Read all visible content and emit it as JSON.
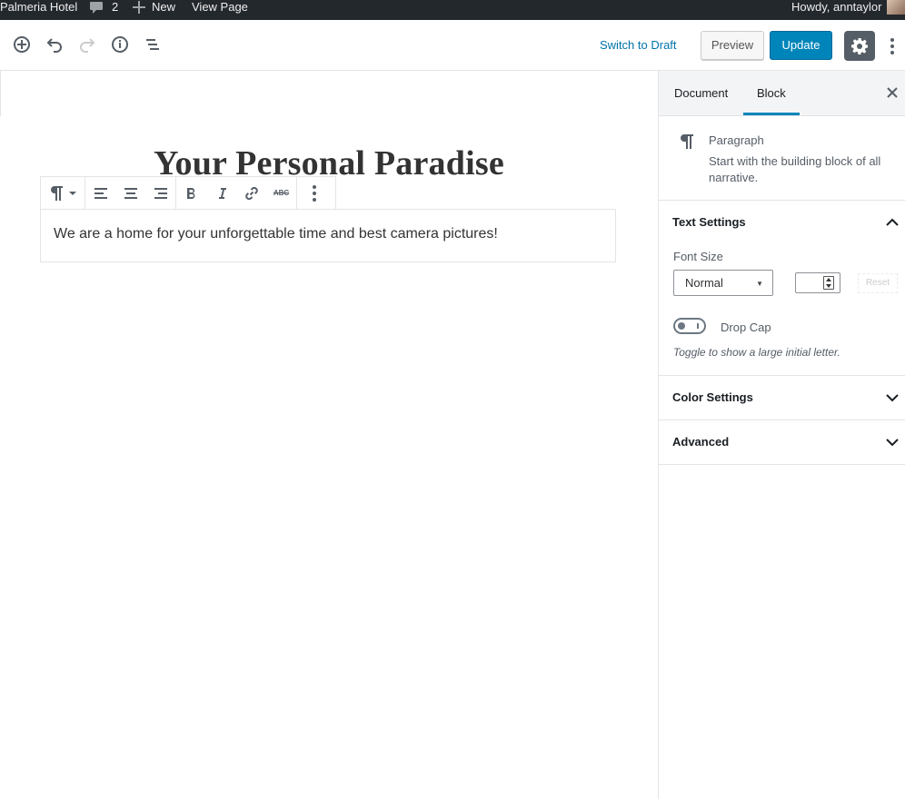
{
  "adminbar": {
    "site_name": "Palmeria Hotel",
    "comments_count": "2",
    "new_label": "New",
    "view_page_label": "View Page",
    "howdy": "Howdy, anntaylor",
    "bg_color": "#23282d"
  },
  "header": {
    "switch_to_draft": "Switch to Draft",
    "preview_label": "Preview",
    "update_label": "Update",
    "icons": [
      "add-block-icon",
      "undo-icon",
      "redo-icon",
      "info-icon",
      "outline-icon",
      "gear-icon",
      "more-vertical-icon"
    ],
    "accent_color": "#0085ba"
  },
  "content": {
    "title": "Your Personal Paradise",
    "paragraph": "We are a home for your unforgettable time and best camera pictures!",
    "toolbar_icons": [
      "paragraph-icon",
      "align-left-icon",
      "align-center-icon",
      "align-right-icon",
      "bold-icon",
      "italic-icon",
      "link-icon",
      "strikethrough-icon",
      "more-options-icon"
    ],
    "strike_label": "ABC"
  },
  "sidebar": {
    "tabs": [
      {
        "label": "Document",
        "active": false
      },
      {
        "label": "Block",
        "active": true
      }
    ],
    "block_card": {
      "title": "Paragraph",
      "description": "Start with the building block of all narrative."
    },
    "text_settings": {
      "title": "Text Settings",
      "expanded": true,
      "font_size_label": "Font Size",
      "font_size_value": "Normal",
      "custom_size_value": "",
      "reset_label": "Reset",
      "drop_cap_label": "Drop Cap",
      "drop_cap_enabled": false,
      "drop_cap_help": "Toggle to show a large initial letter."
    },
    "color_settings": {
      "title": "Color Settings",
      "expanded": false
    },
    "advanced": {
      "title": "Advanced",
      "expanded": false
    }
  }
}
